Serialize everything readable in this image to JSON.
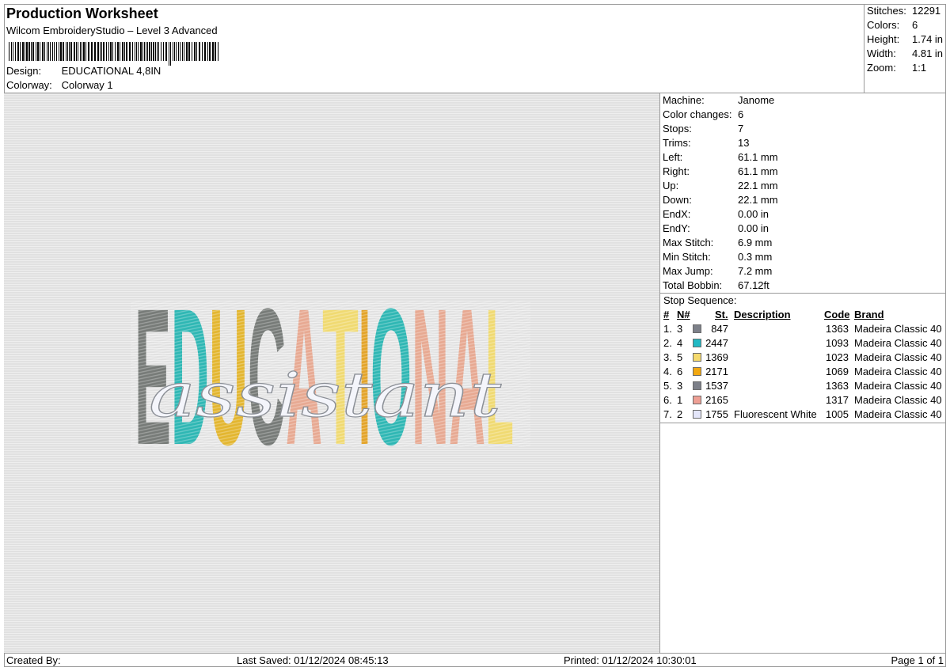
{
  "header": {
    "title": "Production Worksheet",
    "subtitle": "Wilcom EmbroideryStudio – Level 3 Advanced",
    "design_label": "Design:",
    "design_value": "EDUCATIONAL 4,8IN",
    "colorway_label": "Colorway:",
    "colorway_value": "Colorway 1"
  },
  "stats": {
    "stitches_label": "Stitches:",
    "stitches_value": "12291",
    "colors_label": "Colors:",
    "colors_value": "6",
    "height_label": "Height:",
    "height_value": "1.74 in",
    "width_label": "Width:",
    "width_value": "4.81 in",
    "zoom_label": "Zoom:",
    "zoom_value": "1:1"
  },
  "design_preview": {
    "main_word": "EDUCATIONAL",
    "script_word": "assistant",
    "letter_colors": [
      "#777b78",
      "#2fb7b4",
      "#e3b630",
      "#777b78",
      "#e7a992",
      "#f0da72",
      "#e3a42a",
      "#2fb7b4",
      "#e7a992",
      "#e7a992",
      "#f0da72"
    ]
  },
  "machine_info": {
    "machine_label": "Machine:",
    "machine_value": "Janome",
    "color_changes_label": "Color changes:",
    "color_changes_value": "6",
    "stops_label": "Stops:",
    "stops_value": "7",
    "trims_label": "Trims:",
    "trims_value": "13",
    "left_label": "Left:",
    "left_value": "61.1 mm",
    "right_label": "Right:",
    "right_value": "61.1 mm",
    "up_label": "Up:",
    "up_value": "22.1 mm",
    "down_label": "Down:",
    "down_value": "22.1 mm",
    "endx_label": "EndX:",
    "endx_value": "0.00 in",
    "endy_label": "EndY:",
    "endy_value": "0.00 in",
    "max_stitch_label": "Max Stitch:",
    "max_stitch_value": "6.9 mm",
    "min_stitch_label": "Min Stitch:",
    "min_stitch_value": "0.3 mm",
    "max_jump_label": "Max Jump:",
    "max_jump_value": "7.2 mm",
    "total_bobbin_label": "Total Bobbin:",
    "total_bobbin_value": "67.12ft"
  },
  "stop_sequence": {
    "title": "Stop Sequence:",
    "columns": {
      "num": "#",
      "n": "N#",
      "st": "St.",
      "description": "Description",
      "code": "Code",
      "brand": "Brand"
    },
    "rows": [
      {
        "num": "1.",
        "n": "3",
        "color": "#7d8089",
        "st": "847",
        "description": "",
        "code": "1363",
        "brand": "Madeira Classic 40"
      },
      {
        "num": "2.",
        "n": "4",
        "color": "#22b9c4",
        "st": "2447",
        "description": "",
        "code": "1093",
        "brand": "Madeira Classic 40"
      },
      {
        "num": "3.",
        "n": "5",
        "color": "#f5da6e",
        "st": "1369",
        "description": "",
        "code": "1023",
        "brand": "Madeira Classic 40"
      },
      {
        "num": "4.",
        "n": "6",
        "color": "#f2a811",
        "st": "2171",
        "description": "",
        "code": "1069",
        "brand": "Madeira Classic 40"
      },
      {
        "num": "5.",
        "n": "3",
        "color": "#7d8089",
        "st": "1537",
        "description": "",
        "code": "1363",
        "brand": "Madeira Classic 40"
      },
      {
        "num": "6.",
        "n": "1",
        "color": "#ee9f94",
        "st": "2165",
        "description": "",
        "code": "1317",
        "brand": "Madeira Classic 40"
      },
      {
        "num": "7.",
        "n": "2",
        "color": "#e4e6fa",
        "st": "1755",
        "description": "Fluorescent White",
        "code": "1005",
        "brand": "Madeira Classic 40"
      }
    ]
  },
  "footer": {
    "created_by": "Created By:",
    "last_saved": "Last Saved: 01/12/2024 08:45:13",
    "printed": "Printed: 01/12/2024 10:30:01",
    "page": "Page 1 of 1"
  }
}
